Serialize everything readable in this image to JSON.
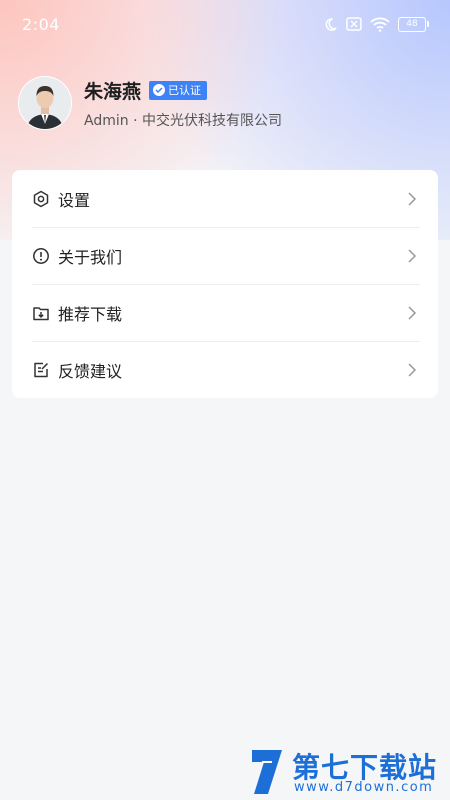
{
  "status_bar": {
    "time": "2:04",
    "battery": "48"
  },
  "profile": {
    "name": "朱海燕",
    "badge": "已认证",
    "subtitle": "Admin · 中交光伏科技有限公司"
  },
  "menu": {
    "items": [
      {
        "label": "设置",
        "icon": "settings-hexagon-icon"
      },
      {
        "label": "关于我们",
        "icon": "info-circle-icon"
      },
      {
        "label": "推荐下载",
        "icon": "download-folder-icon"
      },
      {
        "label": "反馈建议",
        "icon": "edit-note-icon"
      }
    ]
  },
  "watermark": {
    "title": "第七下载站",
    "url": "www.d7down.com"
  },
  "colors": {
    "accent": "#3e82f7",
    "watermark": "#1d6fd8"
  }
}
